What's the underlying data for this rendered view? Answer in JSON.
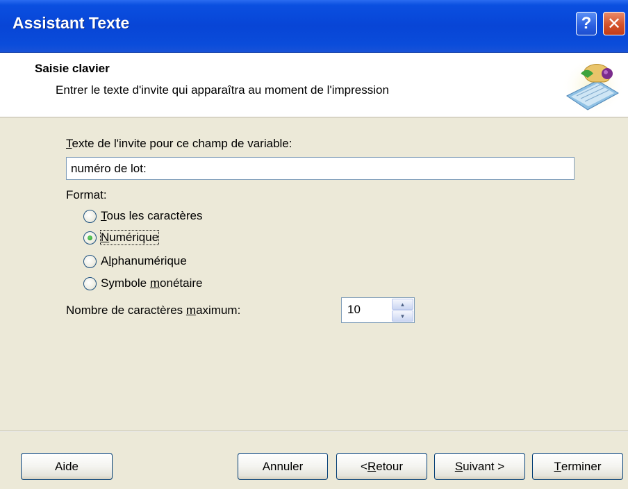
{
  "window": {
    "title": "Assistant Texte",
    "help_glyph": "?",
    "close_glyph": "✕"
  },
  "header": {
    "title": "Saisie clavier",
    "subtitle": "Entrer le texte d'invite qui apparaîtra au moment de l'impression",
    "icon": "keyboard-hand-icon"
  },
  "prompt": {
    "label_first": "T",
    "label_rest": "exte de l'invite pour ce champ de variable:",
    "value": "numéro de lot:"
  },
  "format": {
    "label": "Format:",
    "options": [
      {
        "key": "T",
        "rest": "ous les caractères",
        "checked": false
      },
      {
        "key": "N",
        "rest": "umérique",
        "checked": true
      },
      {
        "key": "A",
        "pre": "",
        "keyletter": "l",
        "rest": "phanumérique",
        "checked": false
      },
      {
        "pre": "Symbole ",
        "keyletter": "m",
        "rest": "onétaire",
        "checked": false
      }
    ]
  },
  "max_chars": {
    "label_pre": "Nombre de caractères ",
    "label_key": "m",
    "label_rest": "aximum:",
    "value": "10"
  },
  "buttons": {
    "help": "Aide",
    "cancel": "Annuler",
    "back_pre": "< ",
    "back_key": "R",
    "back_rest": "etour",
    "next_key": "S",
    "next_rest": "uivant >",
    "finish_key": "T",
    "finish_rest": "erminer"
  },
  "colors": {
    "titlebar": "#0845d6",
    "dialog_bg": "#ece9d8",
    "radio_dot": "#21a121"
  }
}
